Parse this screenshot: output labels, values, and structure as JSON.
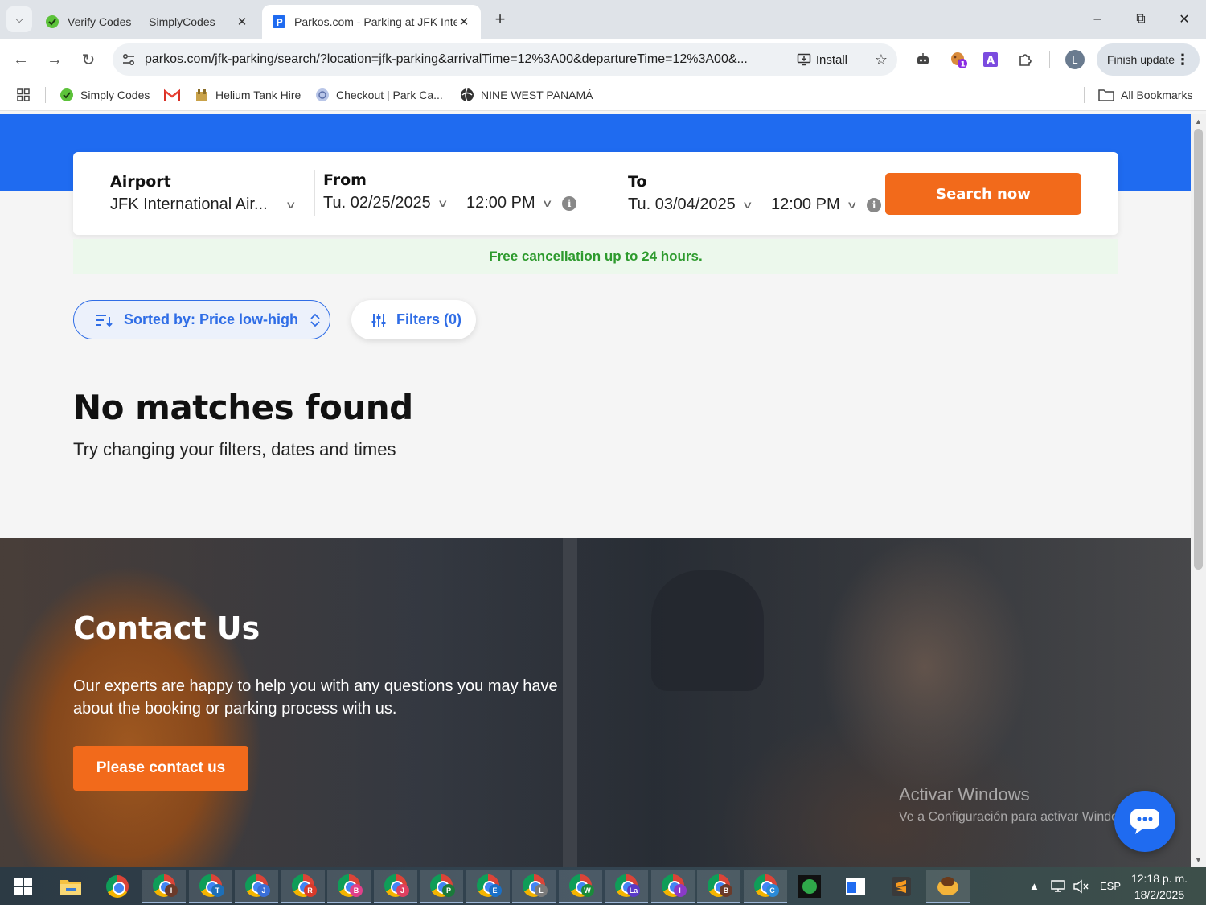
{
  "browser": {
    "tabs": [
      {
        "title": "Verify Codes — SimplyCodes",
        "active": false
      },
      {
        "title": "Parkos.com - Parking at JFK Inte",
        "active": true
      }
    ],
    "url": "parkos.com/jfk-parking/search/?location=jfk-parking&arrivalTime=12%3A00&departureTime=12%3A00&...",
    "install_label": "Install",
    "finish_update_label": "Finish update",
    "profile_initial": "L",
    "extension_badge": "1",
    "bookmarks": [
      "Simply Codes",
      "Helium Tank Hire",
      "Checkout | Park Ca...",
      "NINE WEST PANAMÁ"
    ],
    "all_bookmarks_label": "All Bookmarks"
  },
  "search": {
    "airport_label": "Airport",
    "airport_value": "JFK International Air...",
    "from_label": "From",
    "from_date": "Tu. 02/25/2025",
    "from_time": "12:00 PM",
    "to_label": "To",
    "to_date": "Tu. 03/04/2025",
    "to_time": "12:00 PM",
    "search_button": "Search now"
  },
  "banner": {
    "text": "Free cancellation up to 24 hours."
  },
  "controls": {
    "sort_label": "Sorted by: Price low-high",
    "filters_label": "Filters (0)"
  },
  "results": {
    "title": "No matches found",
    "subtitle": "Try changing your filters, dates and times"
  },
  "contact": {
    "title": "Contact Us",
    "text": "Our experts are happy to help you with any questions you may have about the booking or parking process with us.",
    "button": "Please contact us"
  },
  "watermark": {
    "line1": "Activar Windows",
    "line2": "Ve a Configuración para activar Windows."
  },
  "taskbar": {
    "chrome_profiles": [
      "I",
      "T",
      "J",
      "R",
      "B",
      "J",
      "P",
      "E",
      "L",
      "W",
      "La",
      "I",
      "B",
      "C"
    ],
    "badge_colors": [
      "#6b3a2a",
      "#1d6fb8",
      "#3a6fd8",
      "#d83a2a",
      "#e0408a",
      "#e04060",
      "#1a7a3a",
      "#1a70c8",
      "#7a7a7a",
      "#1a8a3a",
      "#5a3ac8",
      "#8a3ac8",
      "#6a3a2a",
      "#2a8ad8"
    ],
    "language": "ESP",
    "time": "12:18 p. m.",
    "date": "18/2/2025"
  }
}
